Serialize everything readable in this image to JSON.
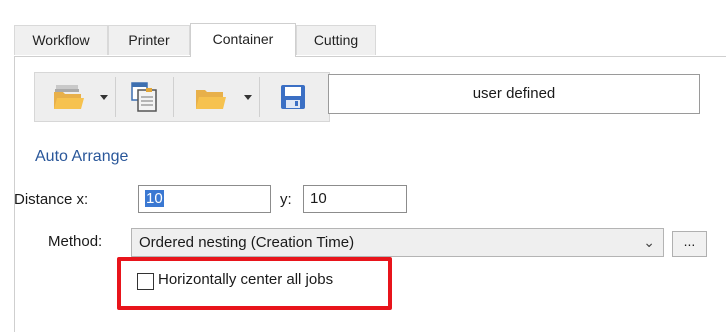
{
  "tabs": [
    {
      "label": "Workflow",
      "active": false
    },
    {
      "label": "Printer",
      "active": false
    },
    {
      "label": "Container",
      "active": true
    },
    {
      "label": "Cutting",
      "active": false
    }
  ],
  "toolbar": {
    "buttons": [
      "open-folder-icon",
      "dropdown-arrow",
      "copy-icon",
      "open-folder-icon",
      "dropdown-arrow",
      "save-icon"
    ]
  },
  "mode_value": "user defined",
  "auto_arrange": {
    "title": "Auto Arrange",
    "distance_x_label": "Distance x:",
    "distance_x_value": "10",
    "y_label": "y:",
    "y_value": "10",
    "method_label": "Method:",
    "method_value": "Ordered nesting (Creation Time)",
    "more_button_label": "...",
    "checkbox_label": "Horizontally center all jobs",
    "checkbox_checked": false
  },
  "colors": {
    "section_title": "#2a579a",
    "highlight": "#e8141b",
    "selection": "#3a78d2"
  }
}
